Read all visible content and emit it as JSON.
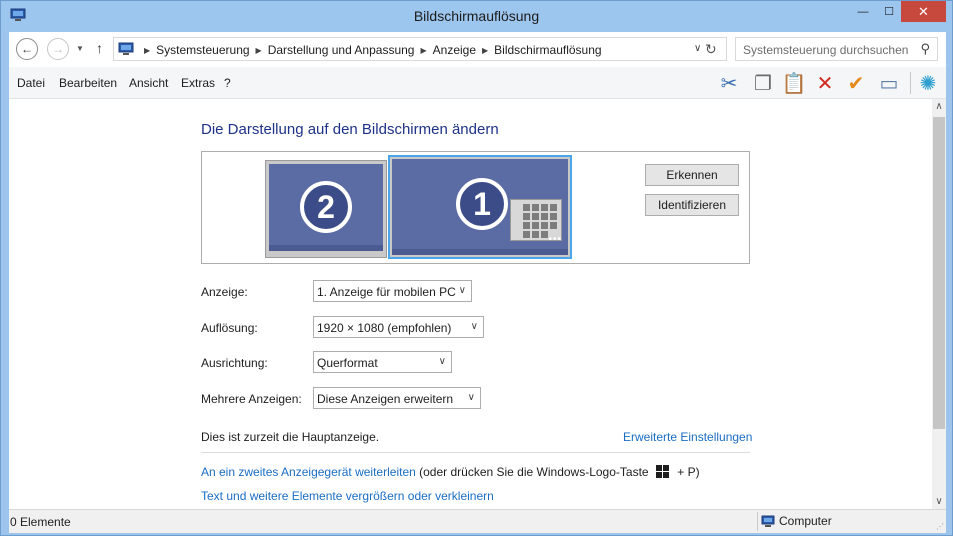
{
  "window": {
    "title": "Bildschirmauflösung",
    "min_glyph": "—",
    "max_glyph": "☐",
    "close_glyph": "✕"
  },
  "nav": {
    "back_glyph": "←",
    "forward_glyph": "→",
    "history_glyph": "▼",
    "up_glyph": "↑",
    "breadcrumbs": [
      "Systemsteuerung",
      "Darstellung und Anpassung",
      "Anzeige",
      "Bildschirmauflösung"
    ],
    "breadcrumb_sep": "▶",
    "address_drop_glyph": "∨",
    "refresh_glyph": "↻",
    "search_placeholder": "Systemsteuerung durchsuchen",
    "search_glyph": "⚲"
  },
  "menu": {
    "items": [
      "Datei",
      "Bearbeiten",
      "Ansicht",
      "Extras",
      "?"
    ]
  },
  "toolbar": {
    "icons": [
      {
        "name": "cut-icon",
        "glyph": "✂",
        "color": "#3a6fb0"
      },
      {
        "name": "copy-icon",
        "glyph": "❐",
        "color": "#6b6b6b"
      },
      {
        "name": "paste-icon",
        "glyph": "📋",
        "color": "#b9873a"
      },
      {
        "name": "delete-icon",
        "glyph": "✕",
        "color": "#d12a1f"
      },
      {
        "name": "check-icon",
        "glyph": "✔",
        "color": "#e58a1c"
      },
      {
        "name": "properties-icon",
        "glyph": "▭",
        "color": "#5c7fa8"
      },
      {
        "name": "shell-icon",
        "glyph": "✺",
        "color": "#2f9fd0"
      }
    ]
  },
  "content": {
    "heading": "Die Darstellung auf den Bildschirmen ändern",
    "monitors": {
      "monitor2_label": "2",
      "monitor1_label": "1",
      "dots": "•••",
      "detect_button": "Erkennen",
      "identify_button": "Identifizieren"
    },
    "settings": [
      {
        "label": "Anzeige:",
        "value": "1. Anzeige für mobilen PC"
      },
      {
        "label": "Auflösung:",
        "value": "1920 × 1080 (empfohlen)"
      },
      {
        "label": "Ausrichtung:",
        "value": "Querformat"
      },
      {
        "label": "Mehrere Anzeigen:",
        "value": "Diese Anzeigen erweitern"
      }
    ],
    "select_chevron": "∨",
    "primary_hint": "Dies ist zurzeit die Hauptanzeige.",
    "advanced_link": "Erweiterte Einstellungen",
    "second_display_link": "An ein zweites Anzeigegerät weiterleiten",
    "second_display_text_a": " (oder drücken Sie die Windows-Logo-Taste ",
    "second_display_text_b": " + P)",
    "text_size_link": "Text und weitere Elemente vergrößern oder verkleinern"
  },
  "scroll": {
    "up_glyph": "∧",
    "down_glyph": "∨"
  },
  "status": {
    "items_count": "0 Elemente",
    "location": "Computer"
  },
  "colors": {
    "title_bar": "#9dc6ee",
    "close_button": "#c7493e",
    "heading": "#1e3287",
    "link": "#1a6dc3",
    "monitor": "#5b6ba3",
    "monitor_selected_border": "#4aa6e8"
  }
}
